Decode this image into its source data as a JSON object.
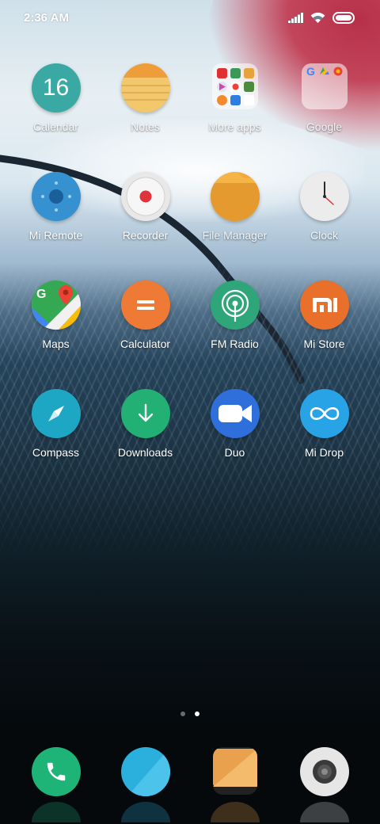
{
  "status_bar": {
    "time": "2:36 AM",
    "icons": [
      "signal-icon",
      "wifi-icon",
      "battery-icon"
    ]
  },
  "apps": [
    {
      "label": "Calendar",
      "icon": "calendar-icon",
      "text": "16",
      "color": "#3aa9a3"
    },
    {
      "label": "Notes",
      "icon": "notes-icon",
      "color": "#f0c060"
    },
    {
      "label": "More apps",
      "icon": "folder-icon"
    },
    {
      "label": "Google",
      "icon": "google-folder-icon"
    },
    {
      "label": "Mi Remote",
      "icon": "remote-icon",
      "color": "#3591d0"
    },
    {
      "label": "Recorder",
      "icon": "record-icon",
      "color": "#e8e8e8"
    },
    {
      "label": "File Manager",
      "icon": "file-manager-icon",
      "color": "#f0a93a"
    },
    {
      "label": "Clock",
      "icon": "clock-icon",
      "color": "#ececec"
    },
    {
      "label": "Maps",
      "icon": "maps-icon"
    },
    {
      "label": "Calculator",
      "icon": "calculator-icon",
      "color": "#ee7a35"
    },
    {
      "label": "FM Radio",
      "icon": "radio-icon",
      "color": "#2fa67a"
    },
    {
      "label": "Mi Store",
      "icon": "mi-store-icon",
      "text": "mi",
      "color": "#e8702a"
    },
    {
      "label": "Compass",
      "icon": "compass-icon",
      "color": "#1ea7c4"
    },
    {
      "label": "Downloads",
      "icon": "download-icon",
      "color": "#23b074"
    },
    {
      "label": "Duo",
      "icon": "duo-icon",
      "color": "#2f6fdc"
    },
    {
      "label": "Mi Drop",
      "icon": "mi-drop-icon",
      "color": "#27a3e6"
    }
  ],
  "pages": {
    "count": 2,
    "active": 2
  },
  "dock": [
    {
      "icon": "phone-icon",
      "color": "#1fb477"
    },
    {
      "icon": "messages-icon",
      "color": "#2bb0dd"
    },
    {
      "icon": "gallery-icon",
      "color": "#e9a14d"
    },
    {
      "icon": "camera-icon",
      "color": "#e6e6e6"
    }
  ]
}
